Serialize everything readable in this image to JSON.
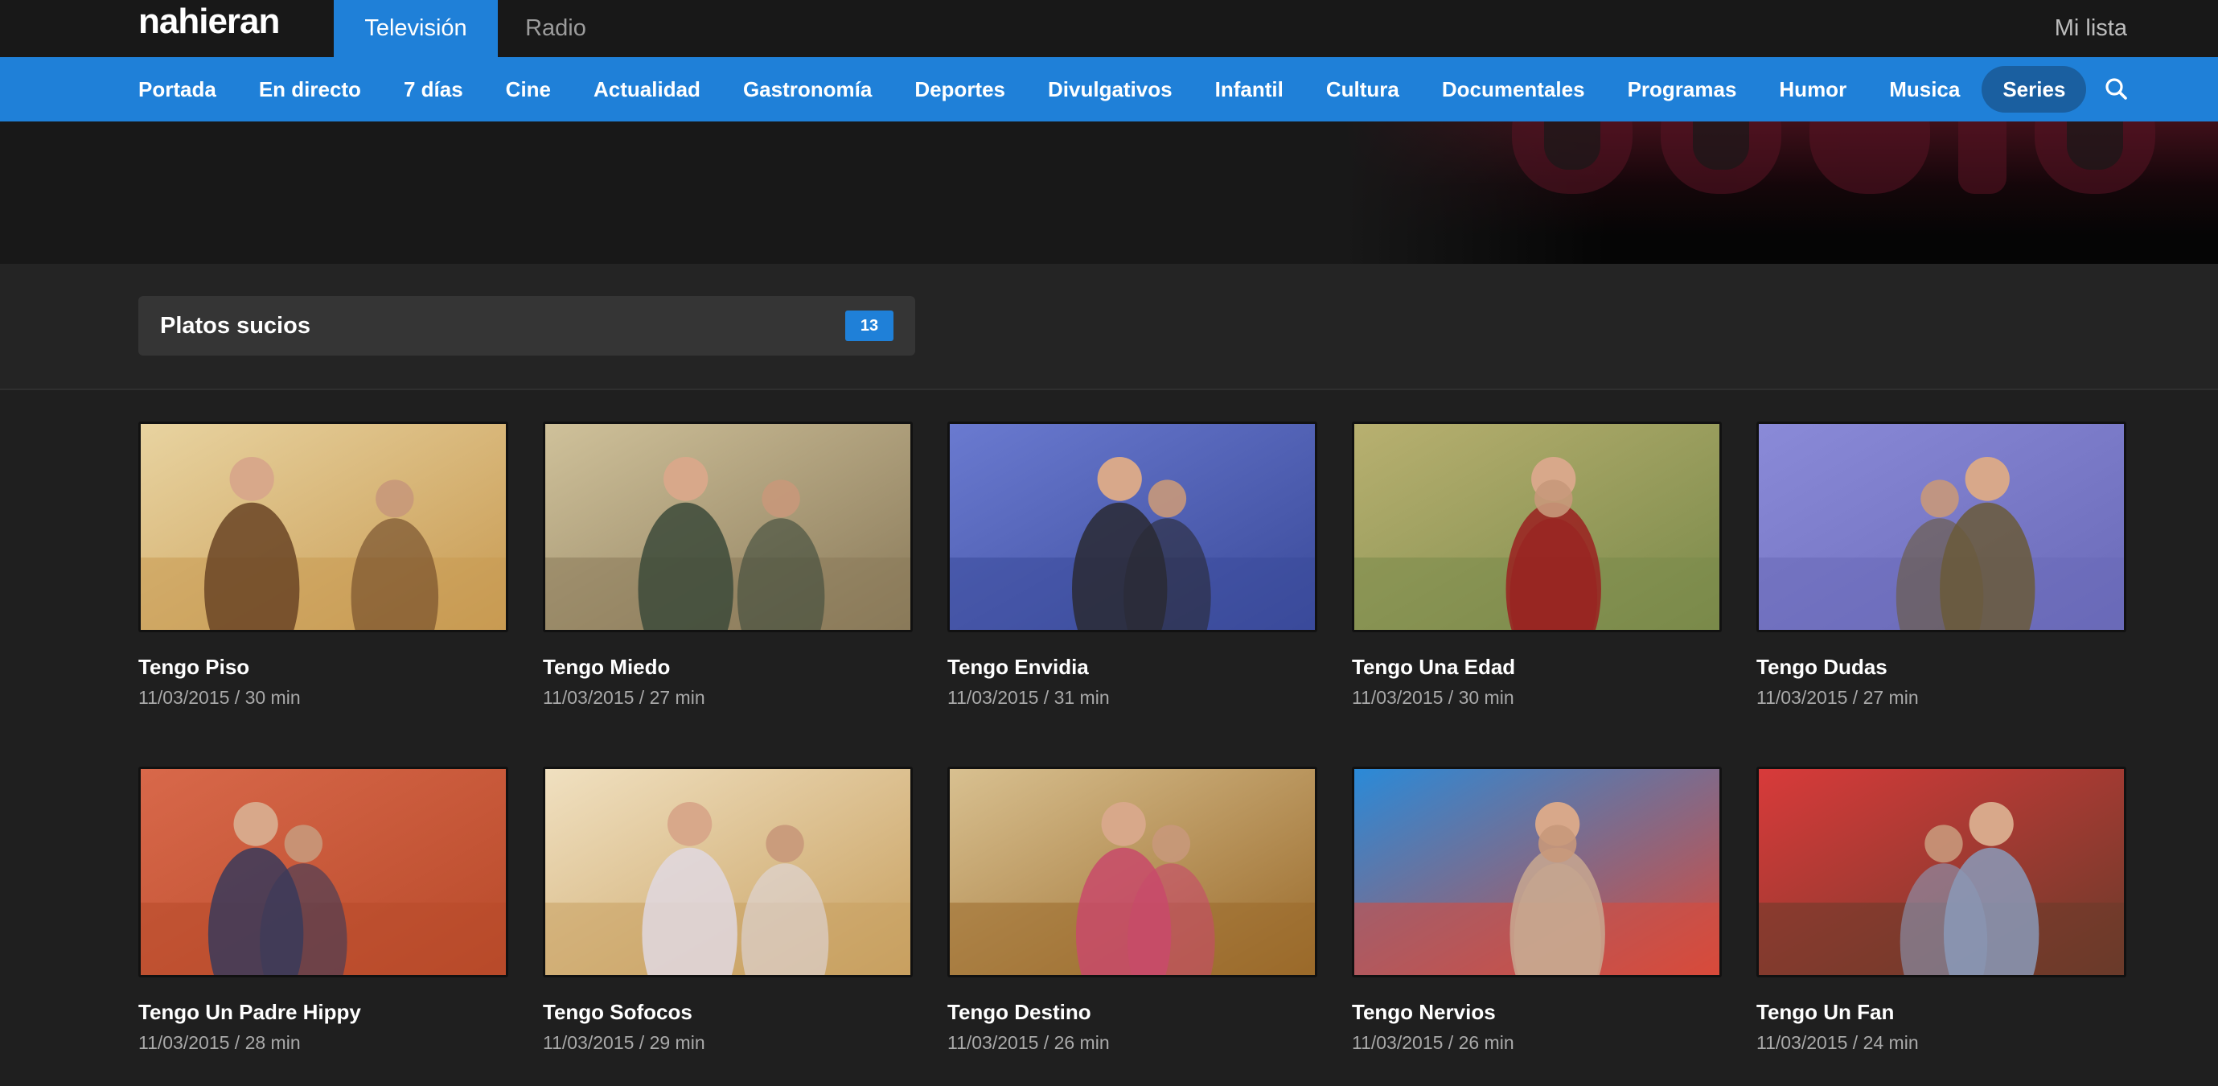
{
  "brand": {
    "logo": "nahieran"
  },
  "media_tabs": [
    {
      "label": "Televisión",
      "active": true
    },
    {
      "label": "Radio",
      "active": false
    }
  ],
  "my_list": "Mi lista",
  "categories": [
    {
      "label": "Portada"
    },
    {
      "label": "En directo"
    },
    {
      "label": "7 días"
    },
    {
      "label": "Cine"
    },
    {
      "label": "Actualidad"
    },
    {
      "label": "Gastronomía"
    },
    {
      "label": "Deportes"
    },
    {
      "label": "Divulgativos"
    },
    {
      "label": "Infantil"
    },
    {
      "label": "Cultura"
    },
    {
      "label": "Documentales"
    },
    {
      "label": "Programas"
    },
    {
      "label": "Humor"
    },
    {
      "label": "Musica"
    },
    {
      "label": "Series",
      "active": true
    }
  ],
  "search": {
    "icon": "search-icon"
  },
  "series": {
    "name": "Platos sucios",
    "count": "13"
  },
  "colors": {
    "accent": "#1f80d8",
    "active_pill": "#1a5fa0",
    "background": "#1f1f1f"
  },
  "episodes": [
    {
      "title": "Tengo Piso",
      "meta": "11/03/2015 / 30 min",
      "palette": [
        "#c89a52",
        "#e8d3a0",
        "#6a4424"
      ]
    },
    {
      "title": "Tengo Miedo",
      "meta": "11/03/2015 / 27 min",
      "palette": [
        "#8a7a5a",
        "#cfc19a",
        "#3c4a3a"
      ]
    },
    {
      "title": "Tengo Envidia",
      "meta": "11/03/2015 / 31 min",
      "palette": [
        "#3a4a9a",
        "#6a7ad0",
        "#2a2a34"
      ]
    },
    {
      "title": "Tengo Una Edad",
      "meta": "11/03/2015 / 30 min",
      "palette": [
        "#7a8a4a",
        "#b8b070",
        "#9a2020"
      ]
    },
    {
      "title": "Tengo Dudas",
      "meta": "11/03/2015 / 27 min",
      "palette": [
        "#6a6ab8",
        "#8a8ad8",
        "#6a5a3a"
      ]
    },
    {
      "title": "Tengo Un Padre Hippy",
      "meta": "11/03/2015 / 28 min",
      "palette": [
        "#b84a2a",
        "#d8684a",
        "#3a3a5a"
      ]
    },
    {
      "title": "Tengo Sofocos",
      "meta": "11/03/2015 / 29 min",
      "palette": [
        "#c8a060",
        "#f0e0c0",
        "#e0d8e0"
      ]
    },
    {
      "title": "Tengo Destino",
      "meta": "11/03/2015 / 26 min",
      "palette": [
        "#9a6a2a",
        "#d8c090",
        "#c84a6a"
      ]
    },
    {
      "title": "Tengo Nervios",
      "meta": "11/03/2015 / 26 min",
      "palette": [
        "#d84a3a",
        "#2a8ad8",
        "#c8a890"
      ]
    },
    {
      "title": "Tengo Un Fan",
      "meta": "11/03/2015 / 24 min",
      "palette": [
        "#6a3a2a",
        "#d83a3a",
        "#8a9ab8"
      ]
    }
  ]
}
